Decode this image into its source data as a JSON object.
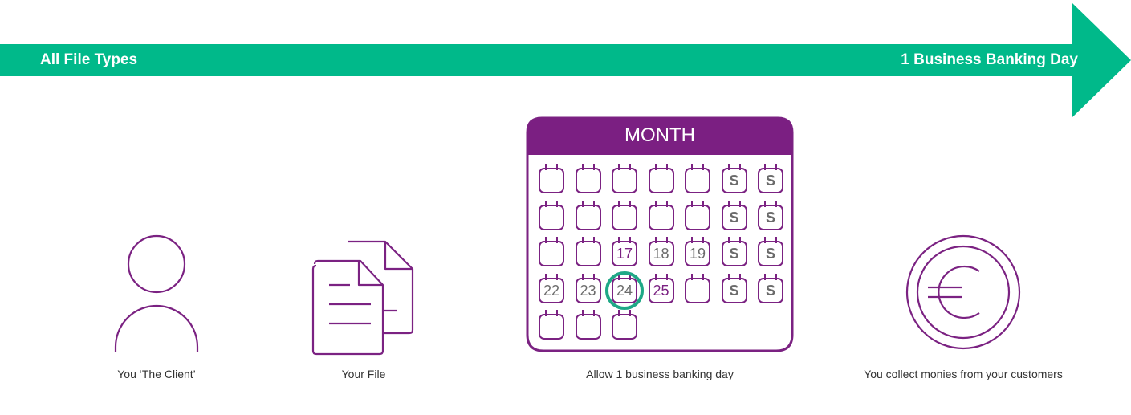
{
  "banner": {
    "left_label": "All File Types",
    "right_label": "1 Business Banking Day",
    "color": "#00b98a"
  },
  "steps": [
    {
      "caption": "You ‘The Client’",
      "icon": "person-icon"
    },
    {
      "caption": "Your File",
      "icon": "documents-icon"
    },
    {
      "caption": "Allow 1 business banking day",
      "icon": "calendar-icon"
    },
    {
      "caption": "You collect monies from your customers",
      "icon": "euro-coin-icon"
    }
  ],
  "calendar": {
    "title": "MONTH",
    "header_color": "#7b1f82",
    "highlight_color": "#1fa886",
    "highlighted_day": "24",
    "rows": [
      [
        "",
        "",
        "",
        "",
        "",
        "S",
        "S"
      ],
      [
        "",
        "",
        "",
        "",
        "",
        "S",
        "S"
      ],
      [
        "",
        "",
        "17",
        "18",
        "19",
        "S",
        "S"
      ],
      [
        "22",
        "23",
        "24",
        "25",
        "",
        "S",
        "S"
      ],
      [
        "",
        "",
        ""
      ]
    ]
  },
  "colors": {
    "purple": "#7b2282",
    "grey_text": "#6b6b6b"
  }
}
